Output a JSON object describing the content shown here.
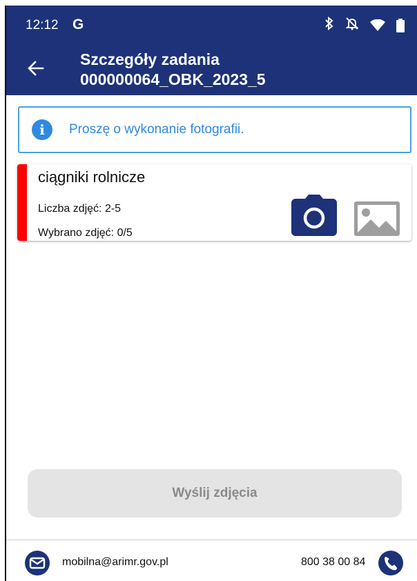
{
  "status_bar": {
    "time": "12:12",
    "google_icon": "G",
    "icons": [
      "bluetooth-icon",
      "notifications-off-icon",
      "wifi-icon",
      "battery-icon"
    ]
  },
  "app_bar": {
    "title_line1": "Szczegóły zadania",
    "title_line2": "000000064_OBK_2023_5",
    "back_icon": "arrow-left-icon",
    "color": "#1d3278"
  },
  "info_banner": {
    "icon": "info-icon",
    "text": "Proszę o wykonanie fotografii.",
    "color": "#2f8ae0"
  },
  "photo_card": {
    "title": "ciągniki rolnicze",
    "count_label": "Liczba zdjęć: 2-5",
    "selected_label": "Wybrano zdjęć: 0/5",
    "status_color": "#ff0000",
    "camera_icon": "camera-icon",
    "gallery_icon": "image-gallery-icon"
  },
  "send_button": {
    "label": "Wyślij zdjęcia"
  },
  "footer": {
    "email": "mobilna@arimr.gov.pl",
    "phone": "800 38 00 84",
    "email_icon": "mail-icon",
    "phone_icon": "phone-icon"
  }
}
